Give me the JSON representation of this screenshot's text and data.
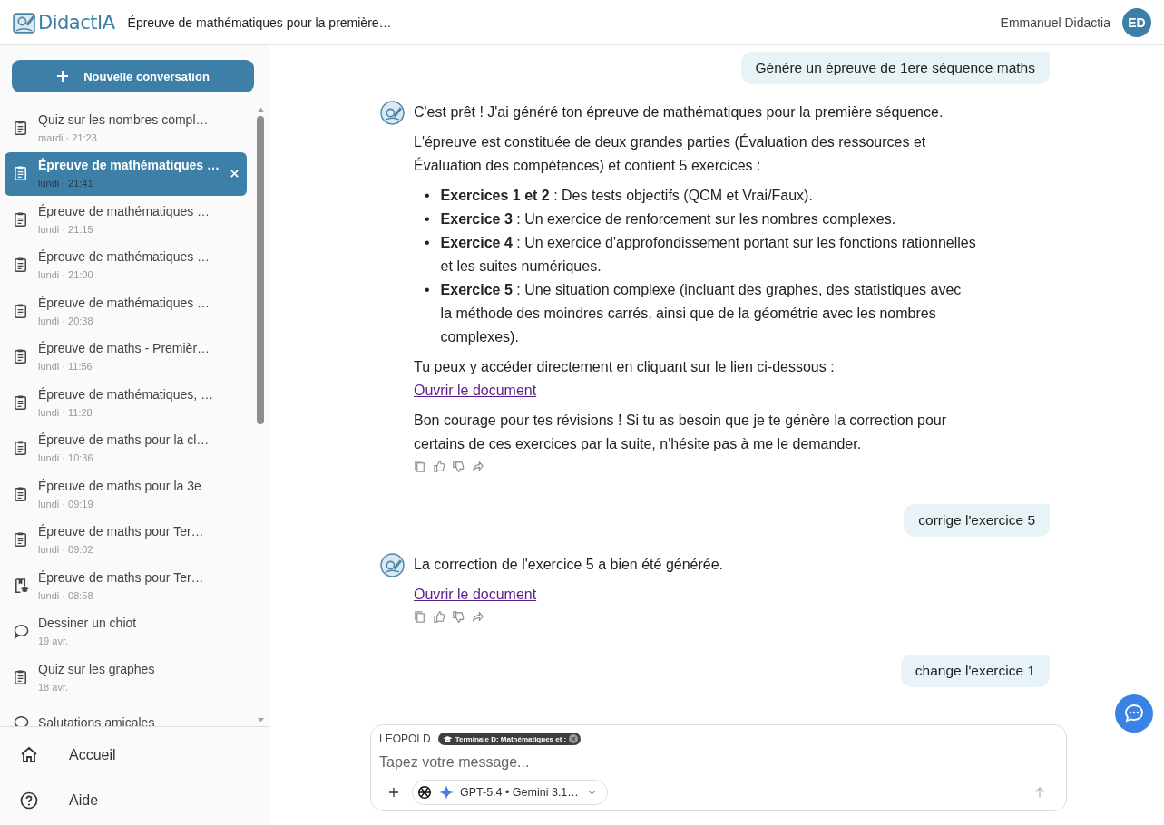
{
  "header": {
    "brand": "DidactIA",
    "title": "Épreuve de mathématiques pour la première…",
    "user": "Emmanuel Didactia",
    "avatar": "ED"
  },
  "sidebar": {
    "new_button": "Nouvelle conversation",
    "items": [
      {
        "kind": "quiz",
        "title": "Quiz sur les nombres compl…",
        "date": "mardi · 21:23",
        "selected": false
      },
      {
        "kind": "quiz",
        "title": "Épreuve de mathématiques …",
        "date": "lundi · 21:41",
        "selected": true
      },
      {
        "kind": "quiz",
        "title": "Épreuve de mathématiques …",
        "date": "lundi · 21:15",
        "selected": false
      },
      {
        "kind": "quiz",
        "title": "Épreuve de mathématiques …",
        "date": "lundi · 21:00",
        "selected": false
      },
      {
        "kind": "quiz",
        "title": "Épreuve de mathématiques …",
        "date": "lundi · 20:38",
        "selected": false
      },
      {
        "kind": "quiz",
        "title": "Épreuve de maths - Premièr…",
        "date": "lundi · 11:56",
        "selected": false
      },
      {
        "kind": "quiz",
        "title": "Épreuve de mathématiques, …",
        "date": "lundi · 11:28",
        "selected": false
      },
      {
        "kind": "quiz",
        "title": "Épreuve de maths pour la cl…",
        "date": "lundi · 10:36",
        "selected": false
      },
      {
        "kind": "quiz",
        "title": "Épreuve de maths pour la 3e",
        "date": "lundi · 09:19",
        "selected": false
      },
      {
        "kind": "quiz",
        "title": "Épreuve de maths pour Ter…",
        "date": "lundi · 09:02",
        "selected": false
      },
      {
        "kind": "course",
        "title": "Épreuve de maths pour Ter…",
        "date": "lundi · 08:58",
        "selected": false
      },
      {
        "kind": "chat",
        "title": "Dessiner un chiot",
        "date": "19 avr.",
        "selected": false
      },
      {
        "kind": "quiz",
        "title": "Quiz sur les graphes",
        "date": "18 avr.",
        "selected": false
      },
      {
        "kind": "chat",
        "title": "Salutations amicales",
        "selected": false
      }
    ],
    "nav": [
      {
        "kind": "home",
        "label": "Accueil"
      },
      {
        "kind": "help",
        "label": "Aide"
      }
    ]
  },
  "messages": [
    {
      "kind": "user",
      "text": "Génère un épreuve de 1ere séquence maths"
    },
    {
      "kind": "assistant",
      "blocks": [
        {
          "kind": "p",
          "text": "C'est prêt ! J'ai généré ton épreuve de mathématiques pour la première séquence."
        },
        {
          "kind": "p",
          "text": "L'épreuve est constituée de deux grandes parties (Évaluation des ressources et Évaluation des compétences) et contient 5 exercices :"
        },
        {
          "kind": "list",
          "items": [
            {
              "bullet": "•",
              "text": "**Exercices 1 et 2** : Des tests objectifs (QCM et Vrai/Faux)."
            },
            {
              "bullet": "•",
              "text": "**Exercice 3** : Un exercice de renforcement sur les nombres complexes."
            },
            {
              "bullet": "•",
              "text": "**Exercice 4** : Un exercice d'approfondissement portant sur les fonctions rationnelles et les suites numériques."
            },
            {
              "bullet": "•",
              "text": "**Exercice 5** : Une situation complexe (incluant des graphes, des statistiques avec la méthode des moindres carrés, ainsi que de la géométrie avec les nombres complexes)."
            }
          ]
        },
        {
          "kind": "p_tight",
          "text": "Tu peux y accéder directement en cliquant sur le lien ci-dessous :"
        },
        {
          "kind": "link",
          "text": "Ouvrir le document"
        },
        {
          "kind": "p",
          "text": "Bon courage pour tes révisions ! Si tu as besoin que je te génère la correction pour certains de ces exercices par la suite, n'hésite pas à me le demander."
        }
      ]
    },
    {
      "kind": "user",
      "text": "corrige l'exercice 5"
    },
    {
      "kind": "assistant",
      "blocks": [
        {
          "kind": "p",
          "text": "La correction de l'exercice 5 a bien été générée."
        },
        {
          "kind": "link",
          "text": "Ouvrir le document"
        }
      ]
    },
    {
      "kind": "user",
      "text": "change l'exercice 1"
    }
  ],
  "composer": {
    "agent": "LEOPOLD",
    "chip": "Terminale D: Mathématiques et :",
    "placeholder": "Tapez votre message...",
    "models": "GPT-5.4 • Gemini 3.1…"
  }
}
